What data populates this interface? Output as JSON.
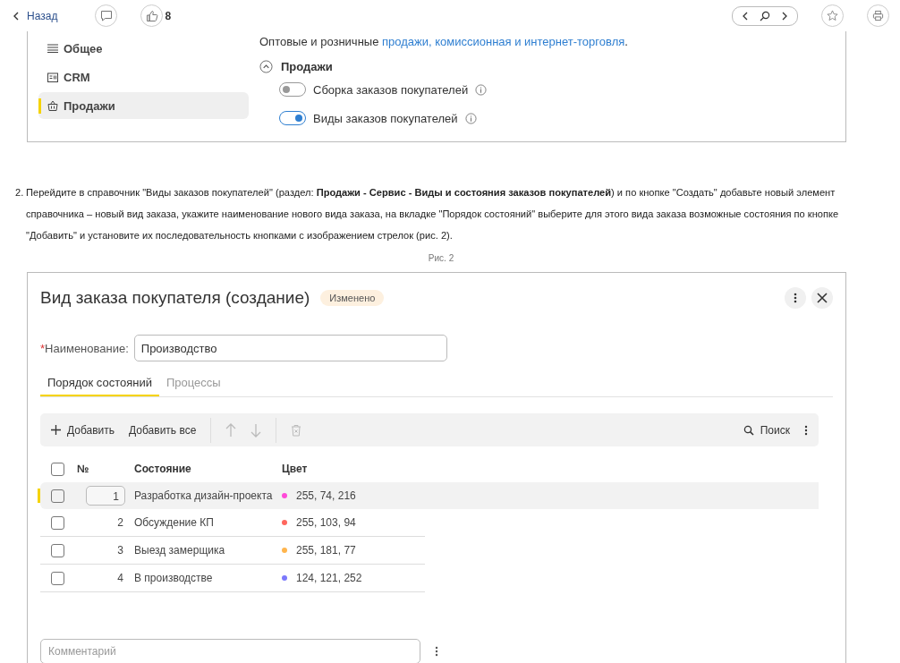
{
  "top_bar": {
    "back": "Назад",
    "likes": "8"
  },
  "settings_panel": {
    "sidebar": [
      {
        "label": "Общее",
        "selected": false
      },
      {
        "label": "CRM",
        "selected": false
      },
      {
        "label": "Продажи",
        "selected": true
      }
    ],
    "description": {
      "text": "Оптовые и розничные ",
      "link": "продажи, комиссионная и интернет-торговля",
      "end": "."
    },
    "section": {
      "title": "Продажи",
      "expanded": true
    },
    "toggles": [
      {
        "label": "Сборка заказов покупателей",
        "on": false
      },
      {
        "label": "Виды заказов покупателей",
        "on": true
      }
    ]
  },
  "instruction": {
    "number": "2.",
    "text": "Перейдите в справочник \"Виды заказов покупателей\" (раздел: **Продажи - Сервис - Виды и состояния заказов покупателей**) и по кнопке \"Создать\" добавьте новый элемент справочника – новый вид заказа, укажите наименование нового вида заказа, на вкладке \"Порядок состояний\" выберите для этого вида заказа возможные состояния по кнопке \"Добавить\" и установите их последовательность кнопками с изображением стрелок  (рис. 2)."
  },
  "caption": "Рис. 2",
  "dialog": {
    "title": "Вид заказа покупателя (создание)",
    "badge": "Изменено",
    "name_label": "Наименование:",
    "required_mark": "*",
    "all_checked": false,
    "name_value": "Производство",
    "tabs": [
      {
        "label": "Порядок состояний",
        "selected": true
      },
      {
        "label": "Процессы",
        "selected": false
      }
    ],
    "toolbar": {
      "add": "Добавить",
      "add_all": "Добавить все",
      "search": "Поиск"
    },
    "columns": [
      "№",
      "Состояние",
      "Цвет"
    ],
    "rows": [
      {
        "number": "1",
        "state": "Разработка дизайн-проекта",
        "color": "#ff4ad8",
        "color_text": "255, 74, 216",
        "selected": true,
        "checked": false
      },
      {
        "number": "2",
        "state": "Обсуждение КП",
        "color": "#ff675e",
        "color_text": "255, 103, 94",
        "selected": false,
        "checked": false
      },
      {
        "number": "3",
        "state": "Выезд замерщика",
        "color": "#ffb54d",
        "color_text": "255, 181, 77",
        "selected": false,
        "checked": false
      },
      {
        "number": "4",
        "state": "В производстве",
        "color": "#7c79fc",
        "color_text": "124, 121, 252",
        "selected": false,
        "checked": false
      }
    ],
    "comment": {
      "placeholder": "Комментарий"
    }
  }
}
